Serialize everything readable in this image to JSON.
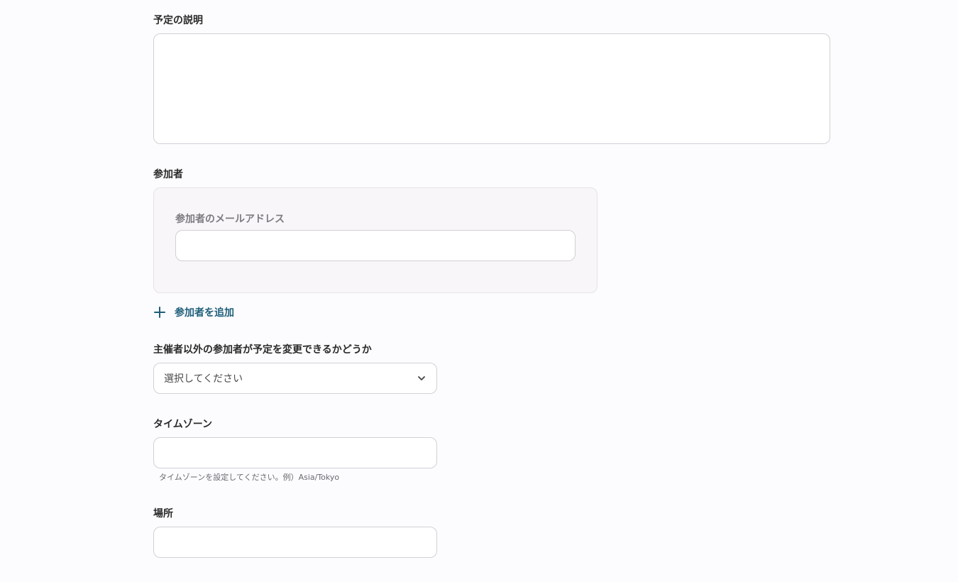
{
  "description": {
    "label": "予定の説明",
    "value": ""
  },
  "attendees": {
    "label": "参加者",
    "email_label": "参加者のメールアドレス",
    "email_value": "",
    "add_label": "参加者を追加"
  },
  "guests_can_modify": {
    "label": "主催者以外の参加者が予定を変更できるかどうか",
    "selected": "選択してください"
  },
  "timezone": {
    "label": "タイムゾーン",
    "value": "",
    "hint": "タイムゾーンを設定してください。例）Asia/Tokyo"
  },
  "location": {
    "label": "場所",
    "value": ""
  },
  "colors": {
    "accent": "#1d5f7a",
    "border": "#d3d0d6",
    "group_bg": "#f8f6f9"
  },
  "icons": {
    "add": "plus-icon",
    "select": "chevron-down-icon"
  }
}
